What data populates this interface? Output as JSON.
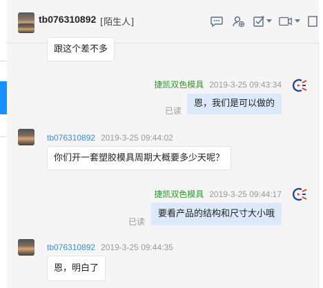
{
  "header": {
    "contact_name": "tb076310892",
    "contact_tag": "[陌生人]",
    "toolbar_icons": [
      "chat-bubble-icon",
      "add-contact-icon",
      "task-checkbox-icon",
      "video-call-icon",
      "more-icon"
    ]
  },
  "messages": [
    {
      "side": "in",
      "text": "跟这个差不多",
      "top": true
    },
    {
      "side": "out",
      "sender": "捷凯双色模具",
      "time": "2019-3-25 09:43:34",
      "text": "恩，我们是可以做的",
      "status": "已读"
    },
    {
      "side": "in",
      "sender": "tb076310892",
      "time": "2019-3-25 09:44:02",
      "text": "你们开一套塑胶模具周期大概要多少天呢？"
    },
    {
      "side": "out",
      "sender": "捷凯双色模具",
      "time": "2019-3-25 09:44:17",
      "text": "要看产品的结构和尺寸大小哦",
      "status": "已读"
    },
    {
      "side": "in",
      "sender": "tb076310892",
      "time": "2019-3-25 09:44:35",
      "text": "恩，明白了"
    }
  ],
  "colors": {
    "accent": "#1890ff",
    "outgoing_bubble": "#dbe9fb",
    "self_name": "#2c9a2c",
    "other_name": "#3a8fd6"
  }
}
